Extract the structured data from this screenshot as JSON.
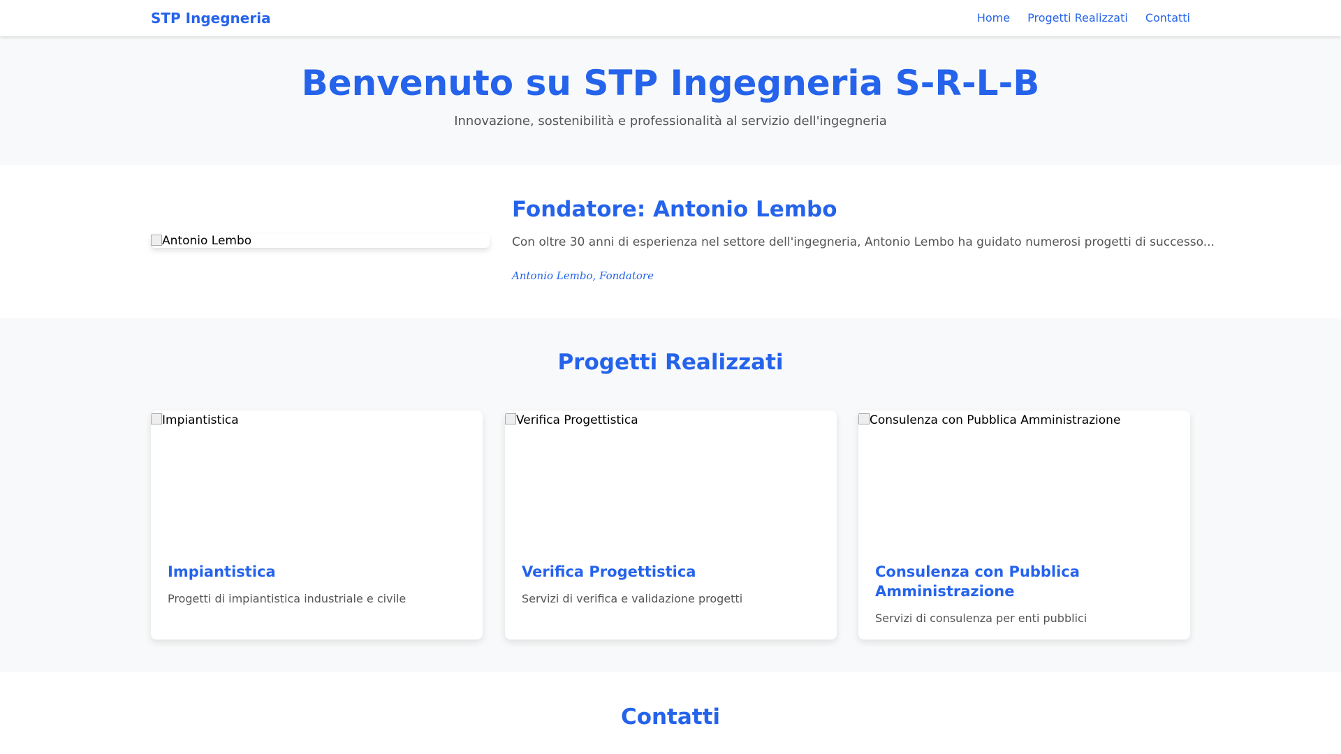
{
  "navbar": {
    "brand": "STP Ingegneria",
    "links": [
      "Home",
      "Progetti Realizzati",
      "Contatti"
    ]
  },
  "hero": {
    "title": "Benvenuto su STP Ingegneria S-R-L-B",
    "subtitle": "Innovazione, sostenibilità e professionalità al servizio dell'ingegneria"
  },
  "founder": {
    "image_alt": "Antonio Lembo",
    "title": "Fondatore: Antonio Lembo",
    "description": "Con oltre 30 anni di esperienza nel settore dell'ingegneria, Antonio Lembo ha guidato numerosi progetti di successo...",
    "signature": "Antonio Lembo, Fondatore"
  },
  "projects": {
    "title": "Progetti Realizzati",
    "cards": [
      {
        "image_alt": "Impiantistica",
        "title": "Impiantistica",
        "description": "Progetti di impiantistica industriale e civile"
      },
      {
        "image_alt": "Verifica Progettistica",
        "title": "Verifica Progettistica",
        "description": "Servizi di verifica e validazione progetti"
      },
      {
        "image_alt": "Consulenza con Pubblica Amministrazione",
        "title": "Consulenza con Pubblica Amministrazione",
        "description": "Servizi di consulenza per enti pubblici"
      }
    ]
  },
  "contacts": {
    "title": "Contatti"
  },
  "colors": {
    "accent": "#2563eb",
    "section_bg": "#f8f9fa",
    "text_muted": "#555555"
  }
}
